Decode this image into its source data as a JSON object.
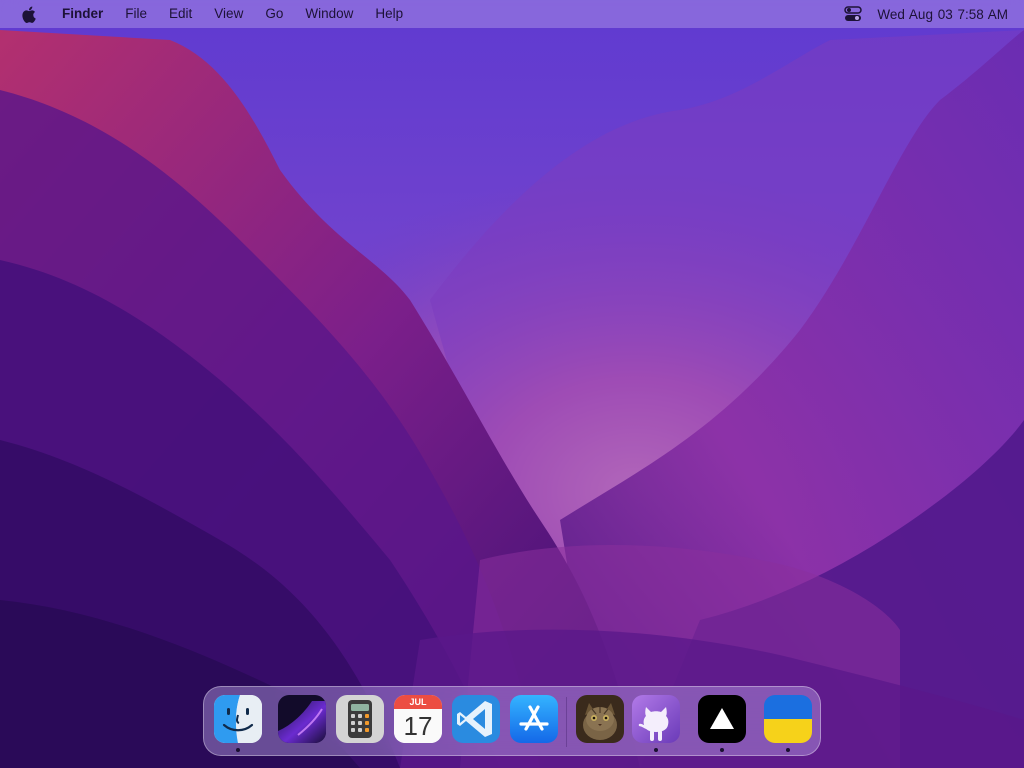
{
  "menubar": {
    "apple_icon": "apple-logo-icon",
    "app_name": "Finder",
    "menus": [
      "File",
      "Edit",
      "View",
      "Go",
      "Window",
      "Help"
    ],
    "control_center_icon": "control-center-icon",
    "clock": "Wed Aug 03  7:58 AM"
  },
  "dock": {
    "apps": [
      {
        "name": "Finder",
        "icon": "finder-icon",
        "running": true
      },
      {
        "name": "Launchpad",
        "icon": "launchpad-icon",
        "running": false
      },
      {
        "name": "Calculator",
        "icon": "calculator-icon",
        "running": false
      },
      {
        "name": "Calendar",
        "icon": "calendar-icon",
        "running": false,
        "month": "JUL",
        "day": "17"
      },
      {
        "name": "Visual Studio Code",
        "icon": "vscode-icon",
        "running": false
      },
      {
        "name": "App Store",
        "icon": "app-store-icon",
        "running": false
      },
      {
        "name": "Cat photo",
        "icon": "cat-photo-icon",
        "running": false
      },
      {
        "name": "GitHub Desktop",
        "icon": "github-icon",
        "running": true
      },
      {
        "name": "Vercel",
        "icon": "vercel-triangle-icon",
        "running": true
      },
      {
        "name": "Ukraine",
        "icon": "ukraine-flag-icon",
        "running": true
      }
    ]
  },
  "colors": {
    "wallpaper_top": "#6a43d6",
    "wallpaper_glow": "#e07aa8",
    "wallpaper_dark": "#2a0d5e"
  }
}
